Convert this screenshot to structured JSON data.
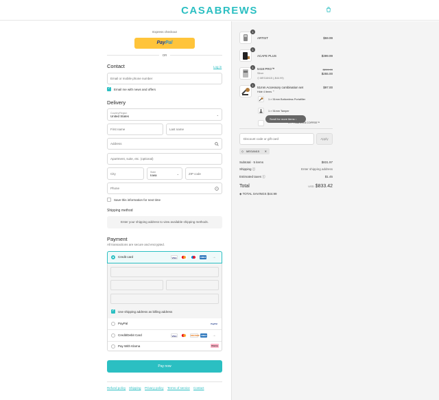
{
  "header": {
    "logo": "CASABREWS",
    "bag_icon": "shopping-bag-icon"
  },
  "express": {
    "title": "Express checkout",
    "paypal_a": "Pay",
    "paypal_b": "Pal",
    "or": "OR"
  },
  "contact": {
    "heading": "Contact",
    "login": "Log in",
    "email_placeholder": "Email or mobile phone number",
    "news_label": "Email me with news and offers"
  },
  "delivery": {
    "heading": "Delivery",
    "country_label": "Country/Region",
    "country_value": "United States",
    "first_name": "First name",
    "last_name": "Last name",
    "address": "Address",
    "apartment": "Apartment, suite, etc. (optional)",
    "city": "City",
    "state_label": "State",
    "state_value": "Iowa",
    "zip": "ZIP code",
    "phone": "Phone",
    "save_label": "Save this information for next time"
  },
  "shipping_method": {
    "heading": "Shipping method",
    "info": "Enter your shipping address to view available shipping methods."
  },
  "payment": {
    "heading": "Payment",
    "subtitle": "All transactions are secure and encrypted.",
    "options": [
      {
        "name": "Credit card",
        "selected": true
      },
      {
        "name": "PayPal",
        "selected": false
      },
      {
        "name": "Credit/Debit Card",
        "selected": false
      },
      {
        "name": "Pay With Klarna",
        "selected": false
      }
    ],
    "billing_label": "Use shipping address as billing address",
    "card_badges": {
      "visa": "VISA",
      "amex": "AMEX",
      "discover": "DISCOVER",
      "paypal": "PayPal",
      "klarna": "Klarna"
    },
    "pay_now": "Pay now"
  },
  "footer": {
    "links": [
      "Refund policy",
      "Shipping",
      "Privacy policy",
      "Terms of service",
      "Contact"
    ]
  },
  "cart": {
    "items": [
      {
        "qty": "1",
        "name": "ARTIST",
        "price": "$59.99"
      },
      {
        "qty": "1",
        "name": "ACAFE PLUS",
        "price": "$399.99"
      },
      {
        "qty": "1",
        "name": "5418 PRO™",
        "variant": "Silver",
        "discount_code": "MEGAN15 (-$44.99)",
        "original_price": "$299.99",
        "price": "$255.00"
      },
      {
        "qty": "1",
        "name": "51mm Accessory combination set",
        "toggle": "Hide 4 items",
        "price": "$97.00",
        "subitems": [
          "1 × 51mm Bottomless Portafilter",
          "1 × 51mm Tamper",
          "1 × …BARISTA COFFEE™"
        ]
      }
    ],
    "scroll_tip": "Scroll for more items",
    "discount_placeholder": "Discount code or gift card",
    "apply": "Apply",
    "applied_code": "MEGAN15",
    "subtotal_label": "Subtotal · 5 items",
    "subtotal": "$831.97",
    "shipping_label": "Shipping",
    "shipping_value": "Enter shipping address",
    "taxes_label": "Estimated taxes",
    "taxes": "$1.45",
    "total_label": "Total",
    "currency": "USD",
    "total": "$833.42",
    "savings_label": "TOTAL SAVINGS",
    "savings": "$44.99"
  },
  "colors": {
    "accent": "#2bbfc2",
    "paypal_yellow": "#ffc43a",
    "sidebar_bg": "#f4f4f4"
  }
}
